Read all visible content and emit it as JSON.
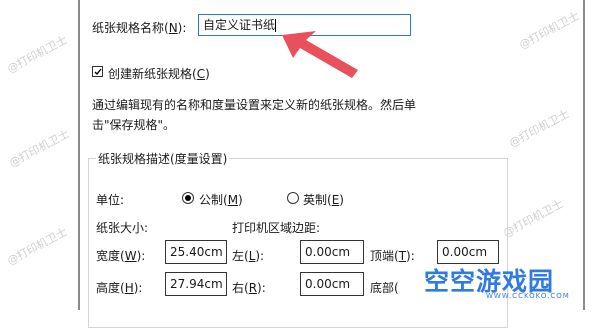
{
  "paper_name": {
    "label": "纸张规格名称(",
    "hotkey": "N",
    "suffix": "):",
    "value": "自定义证书纸"
  },
  "create_new": {
    "label": "创建新纸张规格(",
    "hotkey": "C",
    "suffix": ")",
    "checked": true
  },
  "description": [
    "通过编辑现有的名称和度量设置来定义新的纸张规格。然后单",
    "击\"保存规格\"。"
  ],
  "group": {
    "title": "纸张规格描述(度量设置)",
    "units_label": "单位:",
    "metric": {
      "label": "公制(",
      "hotkey": "M",
      "suffix": ")",
      "selected": true
    },
    "imperial": {
      "label": "英制(",
      "hotkey": "E",
      "suffix": ")",
      "selected": false
    },
    "paper_size_label": "纸张大小:",
    "printer_margins_label": "打印机区域边距:",
    "width": {
      "label": "宽度(",
      "hotkey": "W",
      "suffix": "):",
      "value": "25.40cm"
    },
    "height": {
      "label": "高度(",
      "hotkey": "H",
      "suffix": "):",
      "value": "27.94cm"
    },
    "left": {
      "label": "左(",
      "hotkey": "L",
      "suffix": "):",
      "value": "0.00cm"
    },
    "right": {
      "label": "右(",
      "hotkey": "R",
      "suffix": "):",
      "value": "0.00cm"
    },
    "top": {
      "label": "顶端(",
      "hotkey": "T",
      "suffix": "):",
      "value": "0.00cm"
    },
    "bottom": {
      "label": "底部("
    }
  },
  "watermark": "@打印机卫士",
  "brand": {
    "name": "空空游戏园",
    "url": "WWW.CCKOKO.COM",
    "color": "#2f7be3"
  },
  "arrow_color": "#e8505b"
}
